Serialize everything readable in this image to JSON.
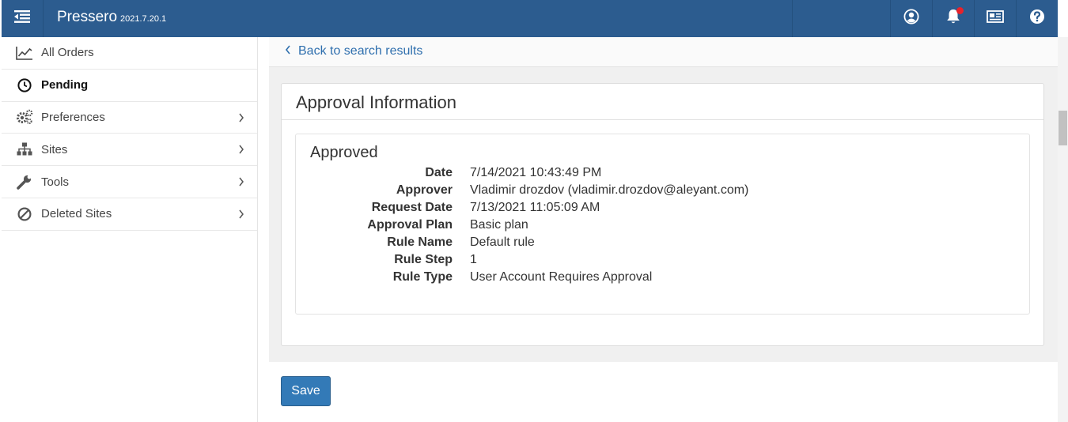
{
  "app": {
    "name": "Pressero",
    "version": "2021.7.20.1",
    "accent_color": "#2c5c8f",
    "notification_dot_color": "#e8222b"
  },
  "topbar": {
    "icons": [
      "menu-toggle-icon",
      "user-icon",
      "bell-icon",
      "news-icon",
      "help-icon"
    ]
  },
  "sidebar": {
    "items": [
      {
        "label": "All Orders",
        "icon": "chart-line-icon",
        "has_chevron": false
      },
      {
        "label": "Pending",
        "icon": "clock-icon",
        "has_chevron": false,
        "active": true
      },
      {
        "label": "Preferences",
        "icon": "gears-icon",
        "has_chevron": true
      },
      {
        "label": "Sites",
        "icon": "sitemap-icon",
        "has_chevron": true
      },
      {
        "label": "Tools",
        "icon": "wrench-icon",
        "has_chevron": true
      },
      {
        "label": "Deleted Sites",
        "icon": "ban-icon",
        "has_chevron": true
      }
    ]
  },
  "main": {
    "back_link": "Back to search results",
    "panel_title": "Approval Information",
    "status_title": "Approved",
    "fields": [
      {
        "label": "Date",
        "value": "7/14/2021 10:43:49 PM"
      },
      {
        "label": "Approver",
        "value": "Vladimir drozdov (vladimir.drozdov@aleyant.com)"
      },
      {
        "label": "Request Date",
        "value": "7/13/2021 11:05:09 AM"
      },
      {
        "label": "Approval Plan",
        "value": "Basic plan"
      },
      {
        "label": "Rule Name",
        "value": "Default rule"
      },
      {
        "label": "Rule Step",
        "value": "1"
      },
      {
        "label": "Rule Type",
        "value": "User Account Requires Approval"
      }
    ],
    "save_label": "Save"
  }
}
